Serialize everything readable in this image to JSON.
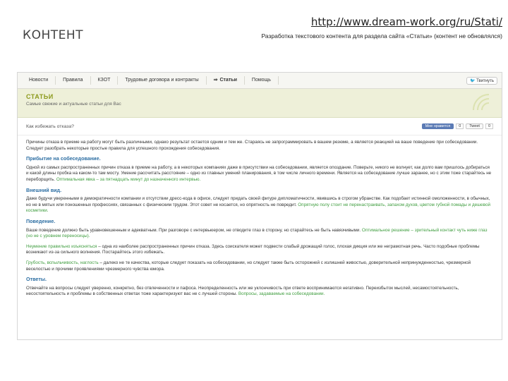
{
  "slide": {
    "title": "КОНТЕНТ",
    "url": "http://www.dream-work.org/ru/Stati/",
    "subtitle": "Разработка текстового контента для раздела сайта «Статьи» (контент не обновлялся)"
  },
  "nav": {
    "items": [
      "Новости",
      "Правила",
      "КЗОТ",
      "Трудовые договора и контракты",
      "Статьи",
      "Помощь"
    ],
    "tweet_label": "Твитнуть"
  },
  "banner": {
    "title": "СТАТЬИ",
    "subtitle": "Самые свежие и актуальные статьи для Вас"
  },
  "article": {
    "question": "Как избежать отказа?",
    "share_label": "Мне нравится",
    "share_count": "0",
    "tweet_label": "Tweet",
    "tweet_count": "0",
    "intro": "Причины отказа в приеме на работу могут быть различными, однако результат остается одним и тем же. Стараясь не запрограммировать в вашем резюме, а является реакцией на ваше поведение при собеседовании. Следует разобрать некоторые простые правила для успешного прохождения собеседования.",
    "sections": [
      {
        "heading": "Прибытие на собеседование.",
        "text": "Одной из самых распространенных причин отказа в приеме на работу, а в некоторых компаниях даже в присутствии на собеседовании, является опоздание. Поверьте, никого не волнует, как долго вам пришлось добираться и какой длины пробка на каком-то там мосту. Умение рассчитать расстояние – одно из главных умений планирования, в том числе личного времени. Является на собеседование лучше заранее, но с этим тоже старайтесь не переборщить.",
        "link": "Оптимальная явка – за пятнадцать минут до назначенного интервью."
      },
      {
        "heading": "Внешний вид.",
        "text": "Даже будучи уверенными в демократичности компании и отсутствии дресс-кода в офисе, следует придать своей фигуре дипломатичности, явившись в строгом убранстве. Как подобает истинной омоложенности, в обычных, но не в мятых или поношенных профессиях, связанных с физическим трудом. Этот совет не косается, но опрятность не повредит.",
        "link": "Опрятную полу стоит не перенастраивать, запахом духов, цветом губной помады и дешевой косметики."
      },
      {
        "heading": "Поведение.",
        "text": "Ваше поведение должно быть уравновешенным и адекватным. При разговоре с интервьюером, не отводите глаз в сторону, но старайтесь не быть навязчивыми.",
        "link": "Оптимальное решение – зрительный контакт чуть ниже глаз (но не с уровнем переносицы)."
      },
      {
        "heading": "",
        "link": "Грубость, вспыльчивость, наглость",
        "text": "– далеко не те качества, которые следует показать на собеседовании, но следует также быть осторожней с излишней живостью, доверительной непринужденностью, чрезмерной веселостью и прочими проявлениями чрезмерного чувства юмора."
      },
      {
        "heading": "Ответы.",
        "text": "Отвечайте на вопросы следует уверенно, конкретно, без отвлеченности и пафоса. Неопределенность или же уклончивость при ответе воспринимаются негативно. Переизбыток мыслей, несамостоятельность, несостоятельность и проблемы в собственных ответах тоже характеризуют вас не с лучшей стороны.",
        "link": "Вопросы, задаваемые на собеседовании."
      }
    ],
    "extra": {
      "link": "Неумение правильно изъясняться",
      "text": "– одна из наиболее распространенных причин отказа. Здесь соискателя может подвести слабый дрожащий голос, плохая дикция или же неграмотная речь. Часто подобные проблемы возникают из-за сильного волнения. Постарайтесь этого избежать."
    }
  }
}
